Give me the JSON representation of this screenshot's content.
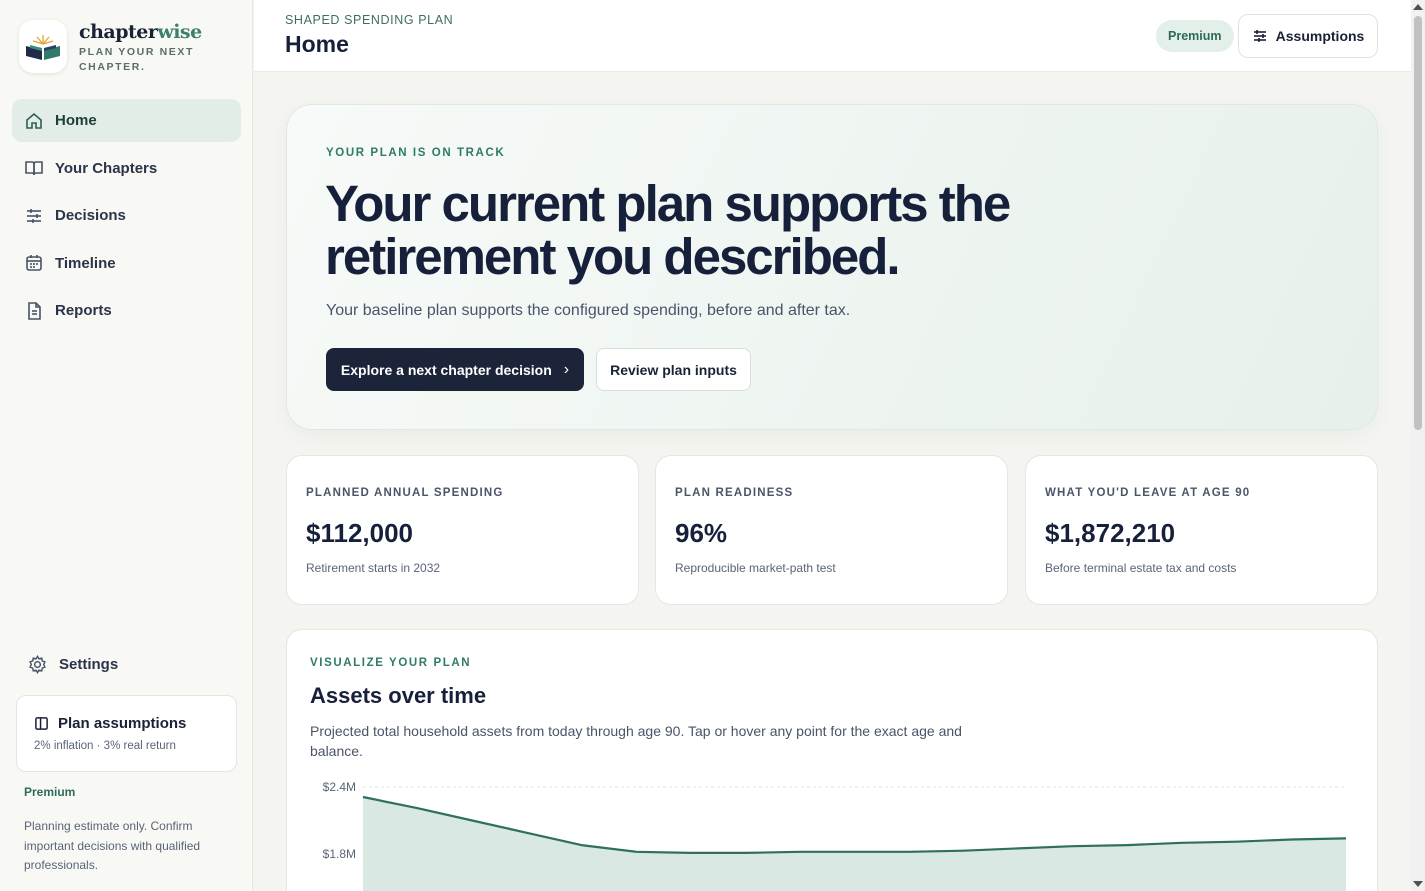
{
  "brand": {
    "name_main": "chapter",
    "name_accent": "wise",
    "tagline": "PLAN YOUR NEXT CHAPTER."
  },
  "sidebar": {
    "items": [
      {
        "label": "Home",
        "icon": "home-icon",
        "active": true
      },
      {
        "label": "Your Chapters",
        "icon": "book-icon",
        "active": false
      },
      {
        "label": "Decisions",
        "icon": "sliders-icon",
        "active": false
      },
      {
        "label": "Timeline",
        "icon": "calendar-icon",
        "active": false
      },
      {
        "label": "Reports",
        "icon": "document-icon",
        "active": false
      }
    ],
    "settings_label": "Settings",
    "assumptions_card": {
      "title": "Plan assumptions",
      "subtitle": "2% inflation · 3% real return"
    },
    "premium_label": "Premium",
    "disclaimer": "Planning estimate only. Confirm important decisions with qualified professionals."
  },
  "header": {
    "eyebrow": "SHAPED SPENDING PLAN",
    "title": "Home",
    "premium_badge": "Premium",
    "assumptions_button": "Assumptions"
  },
  "hero": {
    "eyebrow": "YOUR PLAN IS ON TRACK",
    "title": "Your current plan supports the retirement you described.",
    "subtitle": "Your baseline plan supports the configured spending, before and after tax.",
    "primary_button": "Explore a next chapter decision",
    "secondary_button": "Review plan inputs"
  },
  "metrics": [
    {
      "label": "PLANNED ANNUAL SPENDING",
      "value": "$112,000",
      "sub": "Retirement starts in 2032"
    },
    {
      "label": "PLAN READINESS",
      "value": "96%",
      "sub": "Reproducible market-path test"
    },
    {
      "label": "WHAT YOU'D LEAVE AT AGE 90",
      "value": "$1,872,210",
      "sub": "Before terminal estate tax and costs"
    }
  ],
  "chart_section": {
    "eyebrow": "VISUALIZE YOUR PLAN",
    "title": "Assets over time",
    "description": "Projected total household assets from today through age 90. Tap or hover any point for the exact age and balance."
  },
  "chart_data": {
    "type": "area",
    "title": "Assets over time",
    "y_tick_labels": [
      "$2.4M",
      "$1.8M"
    ],
    "y_ticks": [
      2.4,
      1.8
    ],
    "y_unit": "M",
    "ylim": [
      1.2,
      2.4
    ],
    "grid": true,
    "series": [
      {
        "values": [
          2.31,
          2.21,
          2.1,
          1.99,
          1.88,
          1.82,
          1.81,
          1.81,
          1.82,
          1.82,
          1.82,
          1.83,
          1.85,
          1.87,
          1.88,
          1.9,
          1.91,
          1.93,
          1.94
        ]
      }
    ],
    "colors": {
      "line": "#2f6e61",
      "fill": "#d9e8e2"
    }
  }
}
